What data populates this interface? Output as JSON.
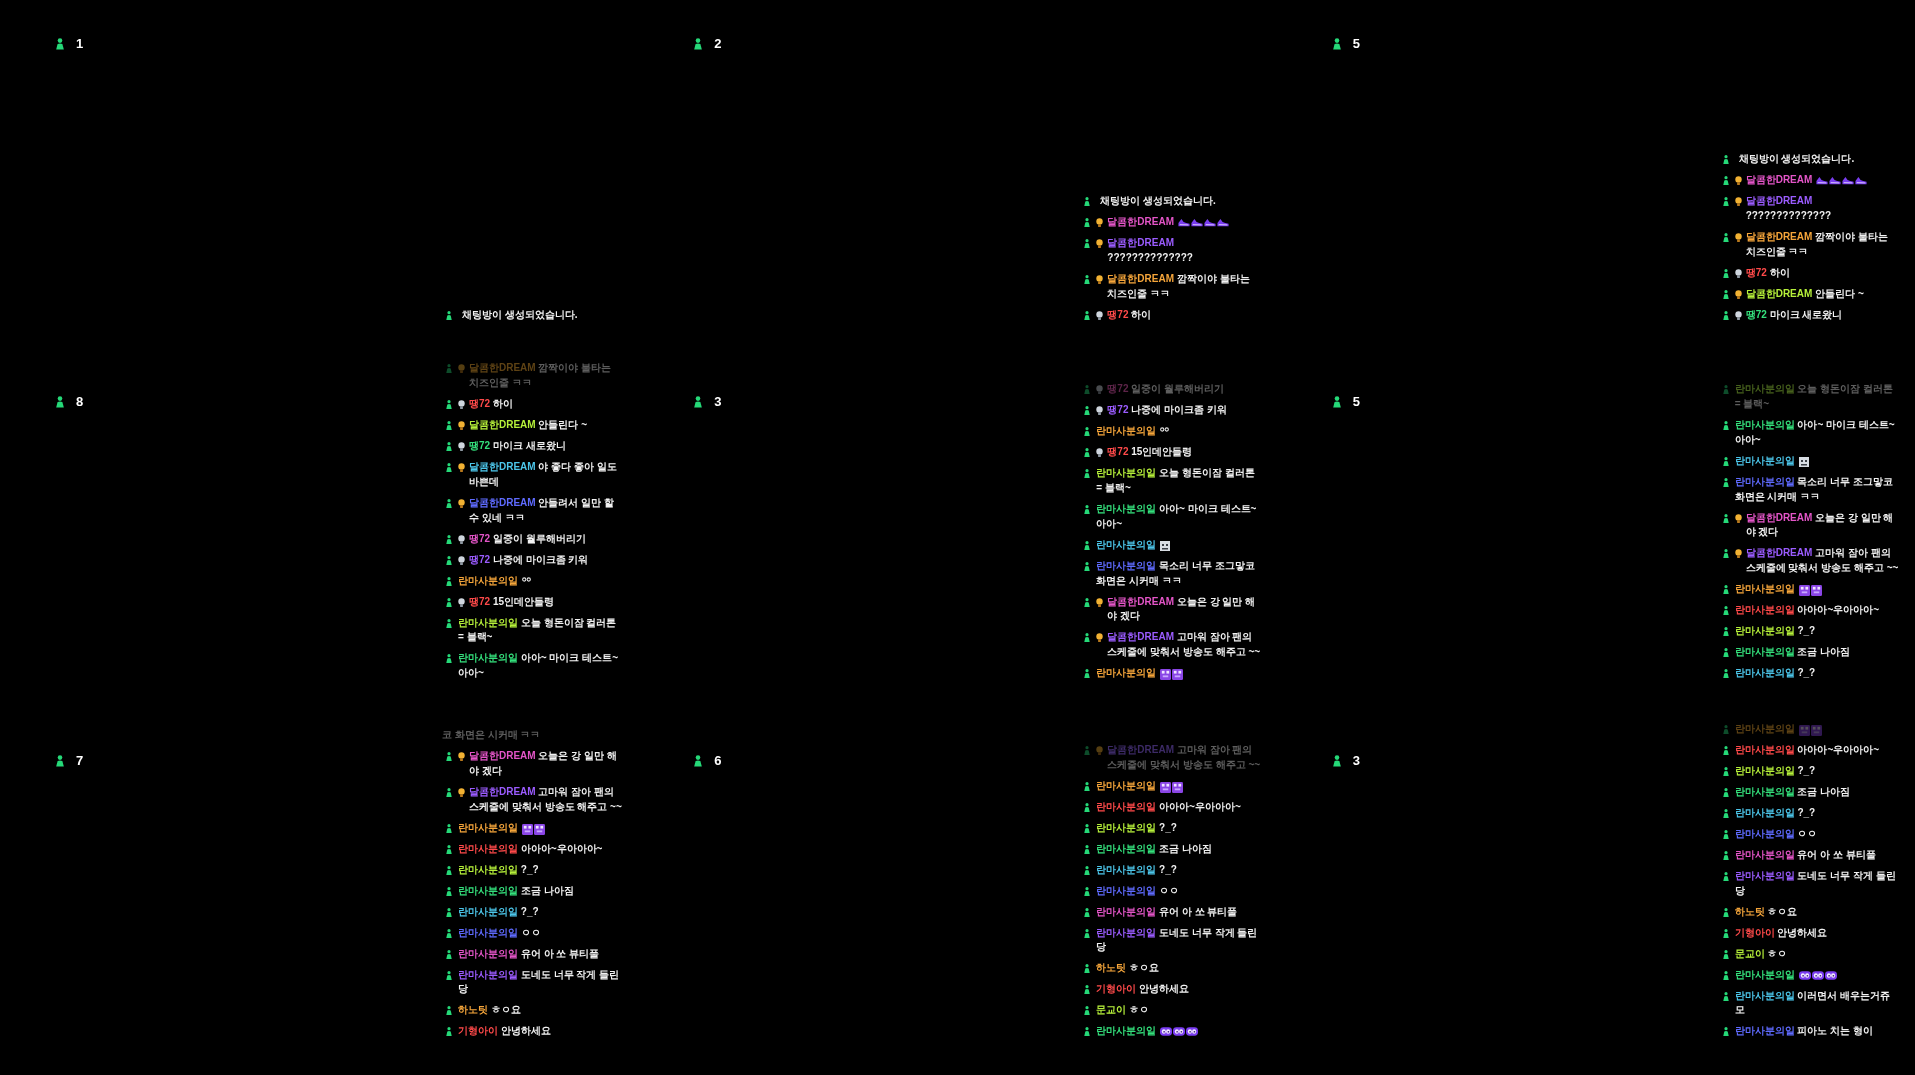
{
  "panels": [
    {
      "viewer_count": "1",
      "chat": [
        {
          "kind": "system",
          "text": "채팅방이 생성되었습니다.",
          "faded": false
        }
      ]
    },
    {
      "viewer_count": "2",
      "chat": [
        {
          "kind": "system",
          "text": "채팅방이 생성되었습니다.",
          "faded": false
        },
        {
          "kind": "message",
          "badge": {
            "kind": "gold"
          },
          "nickname": "달콤한DREAM",
          "color": "#e455c8",
          "emotes": [
            {
              "kind": "shoe"
            },
            {
              "kind": "shoe"
            },
            {
              "kind": "shoe"
            },
            {
              "kind": "shoe"
            }
          ],
          "faded": false
        },
        {
          "kind": "message",
          "badge": {
            "kind": "gold"
          },
          "nickname": "달콤한DREAM",
          "color": "#9b5cff",
          "text": "??????????????",
          "faded": false
        },
        {
          "kind": "message",
          "badge": {
            "kind": "gold"
          },
          "nickname": "달콤한DREAM",
          "color": "#f5a53a",
          "text": "깜짝이야 불타는 치즈인줄 ㅋㅋ",
          "faded": false
        },
        {
          "kind": "message",
          "badge": {
            "kind": "silver"
          },
          "nickname": "땡72",
          "color": "#ff4a4a",
          "text": "하이",
          "faded": false
        }
      ]
    },
    {
      "viewer_count": "5",
      "chat": [
        {
          "kind": "system",
          "text": "채팅방이 생성되었습니다.",
          "faded": false
        },
        {
          "kind": "message",
          "badge": {
            "kind": "gold"
          },
          "nickname": "달콤한DREAM",
          "color": "#e455c8",
          "emotes": [
            {
              "kind": "shoe"
            },
            {
              "kind": "shoe"
            },
            {
              "kind": "shoe"
            },
            {
              "kind": "shoe"
            }
          ],
          "faded": false
        },
        {
          "kind": "message",
          "badge": {
            "kind": "gold"
          },
          "nickname": "달콤한DREAM",
          "color": "#9b5cff",
          "text": "??????????????",
          "faded": false
        },
        {
          "kind": "message",
          "badge": {
            "kind": "gold"
          },
          "nickname": "달콤한DREAM",
          "color": "#f5a53a",
          "text": "깜짝이야 불타는 치즈인줄 ㅋㅋ",
          "faded": false
        },
        {
          "kind": "message",
          "badge": {
            "kind": "silver"
          },
          "nickname": "땡72",
          "color": "#ff4a4a",
          "text": "하이",
          "faded": false
        },
        {
          "kind": "message",
          "badge": {
            "kind": "gold"
          },
          "nickname": "달콤한DREAM",
          "color": "#b6f03a",
          "text": "안들린다 ~",
          "faded": false
        },
        {
          "kind": "message",
          "badge": {
            "kind": "silver"
          },
          "nickname": "땡72",
          "color": "#34e07c",
          "text": "마이크 새로왔니",
          "faded": false
        }
      ]
    },
    {
      "viewer_count": "8",
      "chat": [
        {
          "kind": "message",
          "badge": {
            "kind": "gold"
          },
          "nickname": "달콤한DREAM",
          "color": "#5e4214",
          "text": "깜짝이야 불타는 치즈인줄 ㅋㅋ",
          "faded": true
        },
        {
          "kind": "message",
          "badge": {
            "kind": "silver"
          },
          "nickname": "땡72",
          "color": "#ff4a4a",
          "text": "하이",
          "faded": false
        },
        {
          "kind": "message",
          "badge": {
            "kind": "gold"
          },
          "nickname": "달콤한DREAM",
          "color": "#b6f03a",
          "text": "안들린다 ~",
          "faded": false
        },
        {
          "kind": "message",
          "badge": {
            "kind": "silver"
          },
          "nickname": "땡72",
          "color": "#34e07c",
          "text": "마이크 새로왔니",
          "faded": false
        },
        {
          "kind": "message",
          "badge": {
            "kind": "gold"
          },
          "nickname": "달콤한DREAM",
          "color": "#4cc6ea",
          "text": "야 좋다 좋아 일도 바쁜데",
          "faded": false
        },
        {
          "kind": "message",
          "badge": {
            "kind": "gold"
          },
          "nickname": "달콤한DREAM",
          "color": "#5f6bff",
          "text": "안들려서 일만 할수 있네 ㅋㅋ",
          "faded": false
        },
        {
          "kind": "message",
          "badge": {
            "kind": "silver"
          },
          "nickname": "땡72",
          "color": "#e455c8",
          "text": "일중이 월루해버리기",
          "faded": false
        },
        {
          "kind": "message",
          "badge": {
            "kind": "silver"
          },
          "nickname": "땡72",
          "color": "#9b5cff",
          "text": "나중에 마이크좀 키워",
          "faded": false
        },
        {
          "kind": "message",
          "nickname": "란마사분의일",
          "color": "#f5a53a",
          "emotes": [
            {
              "kind": "rings"
            }
          ],
          "faded": false
        },
        {
          "kind": "message",
          "badge": {
            "kind": "silver"
          },
          "nickname": "땡72",
          "color": "#ff4a4a",
          "text": "15인데안들령",
          "faded": false
        },
        {
          "kind": "message",
          "nickname": "란마사분의일",
          "color": "#b6f03a",
          "text": "오늘 형돈이잠 컬러톤 = 블랙~",
          "faded": false
        },
        {
          "kind": "message",
          "nickname": "란마사분의일",
          "color": "#34e07c",
          "text": "아아~ 마이크 테스트~ 아아~",
          "faded": false
        }
      ]
    },
    {
      "viewer_count": "3",
      "chat": [
        {
          "kind": "message",
          "badge": {
            "kind": "silver"
          },
          "nickname": "땡72",
          "color": "#5c2448",
          "text": "일중이 월루해버리기",
          "faded": true
        },
        {
          "kind": "message",
          "badge": {
            "kind": "silver"
          },
          "nickname": "땡72",
          "color": "#9b5cff",
          "text": "나중에 마이크좀 키워",
          "faded": false
        },
        {
          "kind": "message",
          "nickname": "란마사분의일",
          "color": "#f5a53a",
          "emotes": [
            {
              "kind": "rings"
            }
          ],
          "faded": false
        },
        {
          "kind": "message",
          "badge": {
            "kind": "silver"
          },
          "nickname": "땡72",
          "color": "#ff4a4a",
          "text": "15인데안들령",
          "faded": false
        },
        {
          "kind": "message",
          "nickname": "란마사분의일",
          "color": "#b6f03a",
          "text": "오늘 형돈이잠 컬러톤 = 블랙~",
          "faded": false
        },
        {
          "kind": "message",
          "nickname": "란마사분의일",
          "color": "#34e07c",
          "text": "아아~ 마이크 테스트~ 아아~",
          "faded": false
        },
        {
          "kind": "message",
          "nickname": "란마사분의일",
          "color": "#4cc6ea",
          "emotes": [
            {
              "kind": "face"
            }
          ],
          "faded": false
        },
        {
          "kind": "message",
          "nickname": "란마사분의일",
          "color": "#5f6bff",
          "text": "목소리 너무 조그맣코 화면은 시커매 ㅋㅋ",
          "faded": false
        },
        {
          "kind": "message",
          "badge": {
            "kind": "gold"
          },
          "nickname": "달콤한DREAM",
          "color": "#e455c8",
          "text": "오늘은 강 일만 해야 겠다",
          "faded": false
        },
        {
          "kind": "message",
          "badge": {
            "kind": "gold"
          },
          "nickname": "달콤한DREAM",
          "color": "#9b5cff",
          "text": "고마워 잠아 팬의 스케줄에 맞춰서 방송도 해주고 ~~",
          "faded": false
        },
        {
          "kind": "message",
          "nickname": "란마사분의일",
          "color": "#f5a53a",
          "emotes": [
            {
              "kind": "pixel"
            },
            {
              "kind": "pixel"
            }
          ],
          "faded": false
        }
      ]
    },
    {
      "viewer_count": "5",
      "chat": [
        {
          "kind": "message",
          "nickname": "란마사분의일",
          "color": "#46601c",
          "text": "오늘 형돈이잠 컬러톤 = 블랙~",
          "faded": true
        },
        {
          "kind": "message",
          "nickname": "란마사분의일",
          "color": "#34e07c",
          "text": "아아~ 마이크 테스트~ 아아~",
          "faded": false
        },
        {
          "kind": "message",
          "nickname": "란마사분의일",
          "color": "#4cc6ea",
          "emotes": [
            {
              "kind": "face"
            }
          ],
          "faded": false
        },
        {
          "kind": "message",
          "nickname": "란마사분의일",
          "color": "#5f6bff",
          "text": "목소리 너무 조그맣코 화면은 시커매 ㅋㅋ",
          "faded": false
        },
        {
          "kind": "message",
          "badge": {
            "kind": "gold"
          },
          "nickname": "달콤한DREAM",
          "color": "#e455c8",
          "text": "오늘은 강 일만 해야 겠다",
          "faded": false
        },
        {
          "kind": "message",
          "badge": {
            "kind": "gold"
          },
          "nickname": "달콤한DREAM",
          "color": "#9b5cff",
          "text": "고마워 잠아 팬의 스케줄에 맞춰서 방송도 해주고 ~~",
          "faded": false
        },
        {
          "kind": "message",
          "nickname": "란마사분의일",
          "color": "#f5a53a",
          "emotes": [
            {
              "kind": "pixel"
            },
            {
              "kind": "pixel"
            }
          ],
          "faded": false
        },
        {
          "kind": "message",
          "nickname": "란마사분의일",
          "color": "#ff4a4a",
          "text": "아아아~우아아아~",
          "faded": false
        },
        {
          "kind": "message",
          "nickname": "란마사분의일",
          "color": "#b6f03a",
          "text": "?_?",
          "faded": false
        },
        {
          "kind": "message",
          "nickname": "란마사분의일",
          "color": "#34e07c",
          "text": "조금 나아짐",
          "faded": false
        },
        {
          "kind": "message",
          "nickname": "란마사분의일",
          "color": "#4cc6ea",
          "text": "?_?",
          "faded": false
        }
      ]
    },
    {
      "viewer_count": "7",
      "chat": [
        {
          "kind": "continuation",
          "text": "코 화면은 시커매 ㅋㅋ",
          "faded": true
        },
        {
          "kind": "message",
          "badge": {
            "kind": "gold"
          },
          "nickname": "달콤한DREAM",
          "color": "#e455c8",
          "text": "오늘은 강 일만 해야 겠다",
          "faded": false
        },
        {
          "kind": "message",
          "badge": {
            "kind": "gold"
          },
          "nickname": "달콤한DREAM",
          "color": "#9b5cff",
          "text": "고마워 잠아 팬의 스케줄에 맞춰서 방송도 해주고 ~~",
          "faded": false
        },
        {
          "kind": "message",
          "nickname": "란마사분의일",
          "color": "#f5a53a",
          "emotes": [
            {
              "kind": "pixel"
            },
            {
              "kind": "pixel"
            }
          ],
          "faded": false
        },
        {
          "kind": "message",
          "nickname": "란마사분의일",
          "color": "#ff4a4a",
          "text": "아아아~우아아아~",
          "faded": false
        },
        {
          "kind": "message",
          "nickname": "란마사분의일",
          "color": "#b6f03a",
          "text": "?_?",
          "faded": false
        },
        {
          "kind": "message",
          "nickname": "란마사분의일",
          "color": "#34e07c",
          "text": "조금 나아짐",
          "faded": false
        },
        {
          "kind": "message",
          "nickname": "란마사분의일",
          "color": "#4cc6ea",
          "text": "?_?",
          "faded": false
        },
        {
          "kind": "message",
          "nickname": "란마사분의일",
          "color": "#5f6bff",
          "text": "ㅇㅇ",
          "faded": false
        },
        {
          "kind": "message",
          "nickname": "란마사분의일",
          "color": "#e455c8",
          "text": "유어 아 쏘 뷰티풀",
          "faded": false
        },
        {
          "kind": "message",
          "nickname": "란마사분의일",
          "color": "#9b5cff",
          "text": "도네도 너무 작게 들린당",
          "faded": false
        },
        {
          "kind": "message",
          "nickname": "하노팃",
          "color": "#f5a53a",
          "text": "ㅎㅇ요",
          "faded": false
        },
        {
          "kind": "message",
          "nickname": "기형아이",
          "color": "#ff4a4a",
          "text": "안녕하세요",
          "faded": false
        }
      ]
    },
    {
      "viewer_count": "6",
      "chat": [
        {
          "kind": "message",
          "badge": {
            "kind": "gold"
          },
          "nickname": "달콤한DREAM",
          "color": "#3c2a66",
          "text": "고마워 잠아 팬의 스케줄에 맞춰서 방송도 해주고 ~~",
          "faded": true
        },
        {
          "kind": "message",
          "nickname": "란마사분의일",
          "color": "#f5a53a",
          "emotes": [
            {
              "kind": "pixel"
            },
            {
              "kind": "pixel"
            }
          ],
          "faded": false
        },
        {
          "kind": "message",
          "nickname": "란마사분의일",
          "color": "#ff4a4a",
          "text": "아아아~우아아아~",
          "faded": false
        },
        {
          "kind": "message",
          "nickname": "란마사분의일",
          "color": "#b6f03a",
          "text": "?_?",
          "faded": false
        },
        {
          "kind": "message",
          "nickname": "란마사분의일",
          "color": "#34e07c",
          "text": "조금 나아짐",
          "faded": false
        },
        {
          "kind": "message",
          "nickname": "란마사분의일",
          "color": "#4cc6ea",
          "text": "?_?",
          "faded": false
        },
        {
          "kind": "message",
          "nickname": "란마사분의일",
          "color": "#5f6bff",
          "text": "ㅇㅇ",
          "faded": false
        },
        {
          "kind": "message",
          "nickname": "란마사분의일",
          "color": "#e455c8",
          "text": "유어 아 쏘 뷰티풀",
          "faded": false
        },
        {
          "kind": "message",
          "nickname": "란마사분의일",
          "color": "#9b5cff",
          "text": "도네도 너무 작게 들린당",
          "faded": false
        },
        {
          "kind": "message",
          "nickname": "하노팃",
          "color": "#f5a53a",
          "text": "ㅎㅇ요",
          "faded": false
        },
        {
          "kind": "message",
          "nickname": "기형아이",
          "color": "#ff4a4a",
          "text": "안녕하세요",
          "faded": false
        },
        {
          "kind": "message",
          "nickname": "문교이",
          "color": "#b6f03a",
          "text": "ㅎㅇ",
          "faded": false
        },
        {
          "kind": "message",
          "nickname": "란마사분의일",
          "color": "#34e07c",
          "emotes": [
            {
              "kind": "eyes"
            },
            {
              "kind": "eyes"
            },
            {
              "kind": "eyes"
            }
          ],
          "faded": false
        }
      ]
    },
    {
      "viewer_count": "3",
      "chat": [
        {
          "kind": "message",
          "nickname": "란마사분의일",
          "color": "#5e4214",
          "emotes": [
            {
              "kind": "pixel"
            },
            {
              "kind": "pixel"
            }
          ],
          "faded": true
        },
        {
          "kind": "message",
          "nickname": "란마사분의일",
          "color": "#ff4a4a",
          "text": "아아아~우아아아~",
          "faded": false
        },
        {
          "kind": "message",
          "nickname": "란마사분의일",
          "color": "#b6f03a",
          "text": "?_?",
          "faded": false
        },
        {
          "kind": "message",
          "nickname": "란마사분의일",
          "color": "#34e07c",
          "text": "조금 나아짐",
          "faded": false
        },
        {
          "kind": "message",
          "nickname": "란마사분의일",
          "color": "#4cc6ea",
          "text": "?_?",
          "faded": false
        },
        {
          "kind": "message",
          "nickname": "란마사분의일",
          "color": "#5f6bff",
          "text": "ㅇㅇ",
          "faded": false
        },
        {
          "kind": "message",
          "nickname": "란마사분의일",
          "color": "#e455c8",
          "text": "유어 아 쏘 뷰티풀",
          "faded": false
        },
        {
          "kind": "message",
          "nickname": "란마사분의일",
          "color": "#9b5cff",
          "text": "도네도 너무 작게 들린당",
          "faded": false
        },
        {
          "kind": "message",
          "nickname": "하노팃",
          "color": "#f5a53a",
          "text": "ㅎㅇ요",
          "faded": false
        },
        {
          "kind": "message",
          "nickname": "기형아이",
          "color": "#ff4a4a",
          "text": "안녕하세요",
          "faded": false
        },
        {
          "kind": "message",
          "nickname": "문교이",
          "color": "#b6f03a",
          "text": "ㅎㅇ",
          "faded": false
        },
        {
          "kind": "message",
          "nickname": "란마사분의일",
          "color": "#34e07c",
          "emotes": [
            {
              "kind": "eyes"
            },
            {
              "kind": "eyes"
            },
            {
              "kind": "eyes"
            }
          ],
          "faded": false
        },
        {
          "kind": "message",
          "nickname": "란마사분의일",
          "color": "#4cc6ea",
          "text": "이러면서 배우는거쥬 모",
          "faded": false
        },
        {
          "kind": "message",
          "nickname": "란마사분의일",
          "color": "#5f6bff",
          "text": "피아노 치는 형이",
          "faded": false
        }
      ]
    }
  ]
}
